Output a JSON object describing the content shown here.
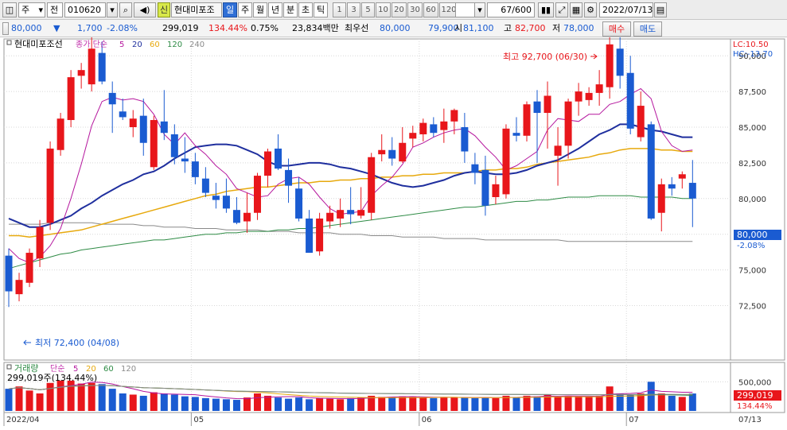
{
  "toolbar": {
    "market": "주",
    "stock_type": "전",
    "code": "010620",
    "new_badge": "신",
    "name": "현대미포조",
    "periods": [
      "일",
      "주",
      "월",
      "년",
      "분",
      "초",
      "틱"
    ],
    "active_period": "일",
    "intervals": [
      "1",
      "3",
      "5",
      "10",
      "20",
      "30",
      "60",
      "120"
    ],
    "count": "67",
    "count_total": "/600",
    "date": "2022/07/13"
  },
  "quote": {
    "price": "80,000",
    "change_arrow": "▼",
    "change": "1,700",
    "change_pct": "-2.08%",
    "volume": "299,019",
    "volume_ratio": "134.44%",
    "turnover": "0.75%",
    "amount": "23,834백만",
    "best_label": "최우선",
    "best_ask": "80,000",
    "best_bid": "79,900",
    "open_label": "시",
    "open": "81,100",
    "high_label": "고",
    "high": "82,700",
    "low_label": "저",
    "low": "78,000",
    "buy_label": "매수",
    "sell_label": "매도"
  },
  "legend": {
    "stock_name": "현대미포조선",
    "ma_label": "종가 단순",
    "ma_periods": [
      "5",
      "20",
      "60",
      "120",
      "240"
    ],
    "ma_colors": [
      "#b5179e",
      "#1f2f9e",
      "#e7a90d",
      "#2e8b45",
      "#8a8a8a"
    ],
    "lc": "LC:10.50",
    "hc": "HC:-13.70",
    "volume_label": "거래량",
    "vol_ma_label": "단순",
    "vol_ma_periods": [
      "5",
      "20",
      "60",
      "120"
    ],
    "vol_ma_colors": [
      "#b5179e",
      "#e7a90d",
      "#2e8b45",
      "#8a8a8a"
    ],
    "volume_value": "299,019주(134.44%)"
  },
  "annotations": {
    "max_label": "최고 92,700 (06/30)",
    "min_label": "최저 72,400 (04/08)",
    "price_tag": "80,000",
    "price_pct": "-2.08%",
    "vol_tag": "299,019",
    "vol_pct": "134.44%"
  },
  "chart_data": {
    "type": "candlestick",
    "price_ticks": [
      72500,
      75000,
      77500,
      80000,
      82500,
      85000,
      87500,
      90000
    ],
    "price_tick_labels": [
      "72,500",
      "75,000",
      "77,500",
      "80,000",
      "82,500",
      "85,000",
      "87,500",
      "90,000"
    ],
    "volume_ticks": [
      500000
    ],
    "volume_tick_labels": [
      "500,000"
    ],
    "month_labels": [
      {
        "index": 0,
        "label": "2022/04"
      },
      {
        "index": 18,
        "label": "05"
      },
      {
        "index": 40,
        "label": "06"
      },
      {
        "index": 60,
        "label": "07"
      }
    ],
    "last_date_label": "07/13",
    "candles": [
      {
        "o": 76000,
        "h": 76500,
        "l": 72400,
        "c": 73500
      },
      {
        "o": 73300,
        "h": 74800,
        "l": 72800,
        "c": 74300
      },
      {
        "o": 74100,
        "h": 76500,
        "l": 73800,
        "c": 76200
      },
      {
        "o": 75800,
        "h": 78500,
        "l": 75200,
        "c": 78000
      },
      {
        "o": 78300,
        "h": 84000,
        "l": 77800,
        "c": 83500
      },
      {
        "o": 83400,
        "h": 86000,
        "l": 83000,
        "c": 85600
      },
      {
        "o": 85500,
        "h": 89000,
        "l": 85000,
        "c": 88500
      },
      {
        "o": 88600,
        "h": 89500,
        "l": 87700,
        "c": 89000
      },
      {
        "o": 88000,
        "h": 91500,
        "l": 87500,
        "c": 90500
      },
      {
        "o": 90200,
        "h": 91000,
        "l": 88000,
        "c": 88200
      },
      {
        "o": 87400,
        "h": 88200,
        "l": 84600,
        "c": 86600
      },
      {
        "o": 86100,
        "h": 87000,
        "l": 85500,
        "c": 85700
      },
      {
        "o": 85000,
        "h": 86200,
        "l": 84300,
        "c": 85600
      },
      {
        "o": 85800,
        "h": 87000,
        "l": 83000,
        "c": 83900
      },
      {
        "o": 82200,
        "h": 85800,
        "l": 82000,
        "c": 85500
      },
      {
        "o": 85400,
        "h": 87600,
        "l": 84100,
        "c": 84600
      },
      {
        "o": 84500,
        "h": 85200,
        "l": 82400,
        "c": 82900
      },
      {
        "o": 82800,
        "h": 84300,
        "l": 81800,
        "c": 82600
      },
      {
        "o": 82600,
        "h": 83200,
        "l": 81000,
        "c": 81500
      },
      {
        "o": 81400,
        "h": 82200,
        "l": 80100,
        "c": 80400
      },
      {
        "o": 80200,
        "h": 81100,
        "l": 79300,
        "c": 79900
      },
      {
        "o": 80200,
        "h": 81400,
        "l": 79000,
        "c": 79300
      },
      {
        "o": 79200,
        "h": 80100,
        "l": 78200,
        "c": 78300
      },
      {
        "o": 78400,
        "h": 80400,
        "l": 77600,
        "c": 79000
      },
      {
        "o": 79000,
        "h": 81800,
        "l": 78500,
        "c": 81600
      },
      {
        "o": 81600,
        "h": 83500,
        "l": 80800,
        "c": 83300
      },
      {
        "o": 83500,
        "h": 84500,
        "l": 82000,
        "c": 82100
      },
      {
        "o": 82000,
        "h": 82800,
        "l": 79700,
        "c": 80900
      },
      {
        "o": 80700,
        "h": 81500,
        "l": 78400,
        "c": 78600
      },
      {
        "o": 78600,
        "h": 79200,
        "l": 77000,
        "c": 76200
      },
      {
        "o": 76300,
        "h": 79000,
        "l": 76000,
        "c": 78600
      },
      {
        "o": 78400,
        "h": 79500,
        "l": 77900,
        "c": 79000
      },
      {
        "o": 78600,
        "h": 80000,
        "l": 78000,
        "c": 79200
      },
      {
        "o": 79200,
        "h": 80800,
        "l": 78200,
        "c": 78900
      },
      {
        "o": 78800,
        "h": 80800,
        "l": 78600,
        "c": 79200
      },
      {
        "o": 79000,
        "h": 83200,
        "l": 78500,
        "c": 82900
      },
      {
        "o": 83100,
        "h": 84500,
        "l": 82600,
        "c": 83400
      },
      {
        "o": 83400,
        "h": 84300,
        "l": 82300,
        "c": 82800
      },
      {
        "o": 82600,
        "h": 85000,
        "l": 82500,
        "c": 83900
      },
      {
        "o": 84200,
        "h": 85100,
        "l": 83600,
        "c": 84600
      },
      {
        "o": 84500,
        "h": 85600,
        "l": 84000,
        "c": 85300
      },
      {
        "o": 85200,
        "h": 85700,
        "l": 84300,
        "c": 84600
      },
      {
        "o": 84800,
        "h": 86300,
        "l": 83900,
        "c": 85400
      },
      {
        "o": 85400,
        "h": 86300,
        "l": 84500,
        "c": 86200
      },
      {
        "o": 85000,
        "h": 86000,
        "l": 82500,
        "c": 83300
      },
      {
        "o": 82400,
        "h": 83200,
        "l": 81000,
        "c": 81800
      },
      {
        "o": 82000,
        "h": 83000,
        "l": 78800,
        "c": 79500
      },
      {
        "o": 80100,
        "h": 81600,
        "l": 79600,
        "c": 81000
      },
      {
        "o": 80300,
        "h": 85200,
        "l": 80000,
        "c": 84900
      },
      {
        "o": 84600,
        "h": 85700,
        "l": 84000,
        "c": 84400
      },
      {
        "o": 84400,
        "h": 86800,
        "l": 84000,
        "c": 86600
      },
      {
        "o": 86800,
        "h": 87600,
        "l": 82500,
        "c": 86000
      },
      {
        "o": 86000,
        "h": 88200,
        "l": 83500,
        "c": 87200
      },
      {
        "o": 83000,
        "h": 85000,
        "l": 80900,
        "c": 83700
      },
      {
        "o": 83700,
        "h": 87000,
        "l": 82800,
        "c": 86800
      },
      {
        "o": 86800,
        "h": 88100,
        "l": 85800,
        "c": 87500
      },
      {
        "o": 86900,
        "h": 87800,
        "l": 86500,
        "c": 87400
      },
      {
        "o": 87400,
        "h": 89000,
        "l": 86500,
        "c": 88000
      },
      {
        "o": 87800,
        "h": 92700,
        "l": 87000,
        "c": 90800
      },
      {
        "o": 90500,
        "h": 91500,
        "l": 87700,
        "c": 88600
      },
      {
        "o": 88800,
        "h": 90000,
        "l": 84500,
        "c": 84900
      },
      {
        "o": 84300,
        "h": 87500,
        "l": 84000,
        "c": 86500
      },
      {
        "o": 85200,
        "h": 85400,
        "l": 78500,
        "c": 78600
      },
      {
        "o": 79000,
        "h": 81400,
        "l": 77700,
        "c": 81000
      },
      {
        "o": 81000,
        "h": 81500,
        "l": 80200,
        "c": 80700
      },
      {
        "o": 81400,
        "h": 81900,
        "l": 80700,
        "c": 81700
      },
      {
        "o": 81100,
        "h": 82700,
        "l": 78000,
        "c": 80000
      }
    ],
    "volumes": [
      380000,
      420000,
      350000,
      300000,
      480000,
      520000,
      520000,
      470000,
      480000,
      460000,
      380000,
      300000,
      280000,
      260000,
      320000,
      300000,
      280000,
      250000,
      240000,
      220000,
      210000,
      200000,
      190000,
      230000,
      300000,
      260000,
      230000,
      210000,
      230000,
      200000,
      220000,
      210000,
      200000,
      220000,
      230000,
      260000,
      240000,
      240000,
      250000,
      240000,
      230000,
      220000,
      230000,
      240000,
      230000,
      220000,
      230000,
      220000,
      260000,
      230000,
      260000,
      250000,
      280000,
      240000,
      260000,
      250000,
      240000,
      260000,
      420000,
      300000,
      280000,
      300000,
      500000,
      300000,
      260000,
      240000,
      299019
    ],
    "ma5": [
      76500,
      75800,
      75500,
      75900,
      76700,
      77900,
      80000,
      82400,
      85100,
      86800,
      87100,
      86900,
      87000,
      86800,
      85900,
      84500,
      83800,
      84600,
      83700,
      83100,
      82300,
      81700,
      80700,
      80400,
      80100,
      80200,
      81000,
      81400,
      81500,
      81000,
      80100,
      79300,
      78900,
      79000,
      79100,
      80200,
      80900,
      81500,
      82400,
      83600,
      83900,
      84300,
      84600,
      84800,
      84900,
      84400,
      83600,
      82900,
      82000,
      82300,
      82800,
      83300,
      84800,
      85600,
      85500,
      85400,
      85900,
      85900,
      86600,
      86800,
      87300,
      87700,
      87000,
      84700,
      83700,
      83300,
      83400
    ],
    "ma20": [
      78600,
      78300,
      78000,
      78000,
      78200,
      78500,
      78800,
      79300,
      79700,
      80200,
      80600,
      81000,
      81300,
      81700,
      81900,
      82300,
      82800,
      83200,
      83600,
      83700,
      83800,
      83800,
      83700,
      83400,
      83100,
      82600,
      82300,
      82300,
      82400,
      82500,
      82500,
      82400,
      82200,
      82100,
      81900,
      81700,
      81400,
      81100,
      80900,
      80800,
      80900,
      81100,
      81300,
      81600,
      81800,
      81900,
      81800,
      81700,
      81700,
      81800,
      82000,
      82300,
      82500,
      82700,
      83100,
      83500,
      84000,
      84500,
      84800,
      85200,
      85200,
      85000,
      84800,
      84700,
      84500,
      84300,
      84300
    ],
    "ma60": [
      77400,
      77400,
      77300,
      77400,
      77500,
      77600,
      77700,
      77800,
      78000,
      78200,
      78400,
      78600,
      78800,
      79000,
      79200,
      79400,
      79600,
      79800,
      80000,
      80200,
      80300,
      80500,
      80600,
      80700,
      80800,
      80800,
      80900,
      81000,
      81100,
      81100,
      81200,
      81200,
      81300,
      81300,
      81400,
      81400,
      81500,
      81500,
      81600,
      81600,
      81700,
      81700,
      81800,
      81800,
      81800,
      81900,
      82000,
      82000,
      82100,
      82100,
      82200,
      82400,
      82500,
      82600,
      82700,
      82800,
      82900,
      83100,
      83200,
      83400,
      83500,
      83500,
      83500,
      83400,
      83400,
      83300,
      83300
    ],
    "ma120": [
      75100,
      75300,
      75500,
      75700,
      75900,
      76100,
      76200,
      76400,
      76500,
      76600,
      76700,
      76800,
      76900,
      77000,
      77100,
      77100,
      77200,
      77300,
      77400,
      77500,
      77500,
      77600,
      77600,
      77700,
      77700,
      77700,
      77800,
      77800,
      77900,
      77900,
      78000,
      78100,
      78200,
      78300,
      78400,
      78500,
      78600,
      78700,
      78800,
      78900,
      79000,
      79100,
      79200,
      79300,
      79400,
      79400,
      79500,
      79600,
      79700,
      79800,
      79800,
      79900,
      79900,
      80000,
      80100,
      80100,
      80100,
      80200,
      80200,
      80200,
      80200,
      80100,
      80100,
      80100,
      80100,
      80000,
      80000
    ],
    "ma240": [
      78200,
      78200,
      78200,
      78200,
      78300,
      78300,
      78300,
      78300,
      78300,
      78200,
      78200,
      78200,
      78200,
      78100,
      78100,
      78000,
      78000,
      78000,
      77900,
      77900,
      77900,
      77800,
      77800,
      77800,
      77800,
      77700,
      77700,
      77700,
      77600,
      77600,
      77600,
      77600,
      77500,
      77500,
      77500,
      77400,
      77400,
      77400,
      77300,
      77300,
      77300,
      77300,
      77200,
      77200,
      77200,
      77200,
      77100,
      77100,
      77100,
      77100,
      77100,
      77100,
      77100,
      77100,
      77000,
      77000,
      77000,
      77000,
      77000,
      77000,
      77000,
      77000,
      77000,
      77000,
      77000,
      77000,
      77000
    ]
  }
}
